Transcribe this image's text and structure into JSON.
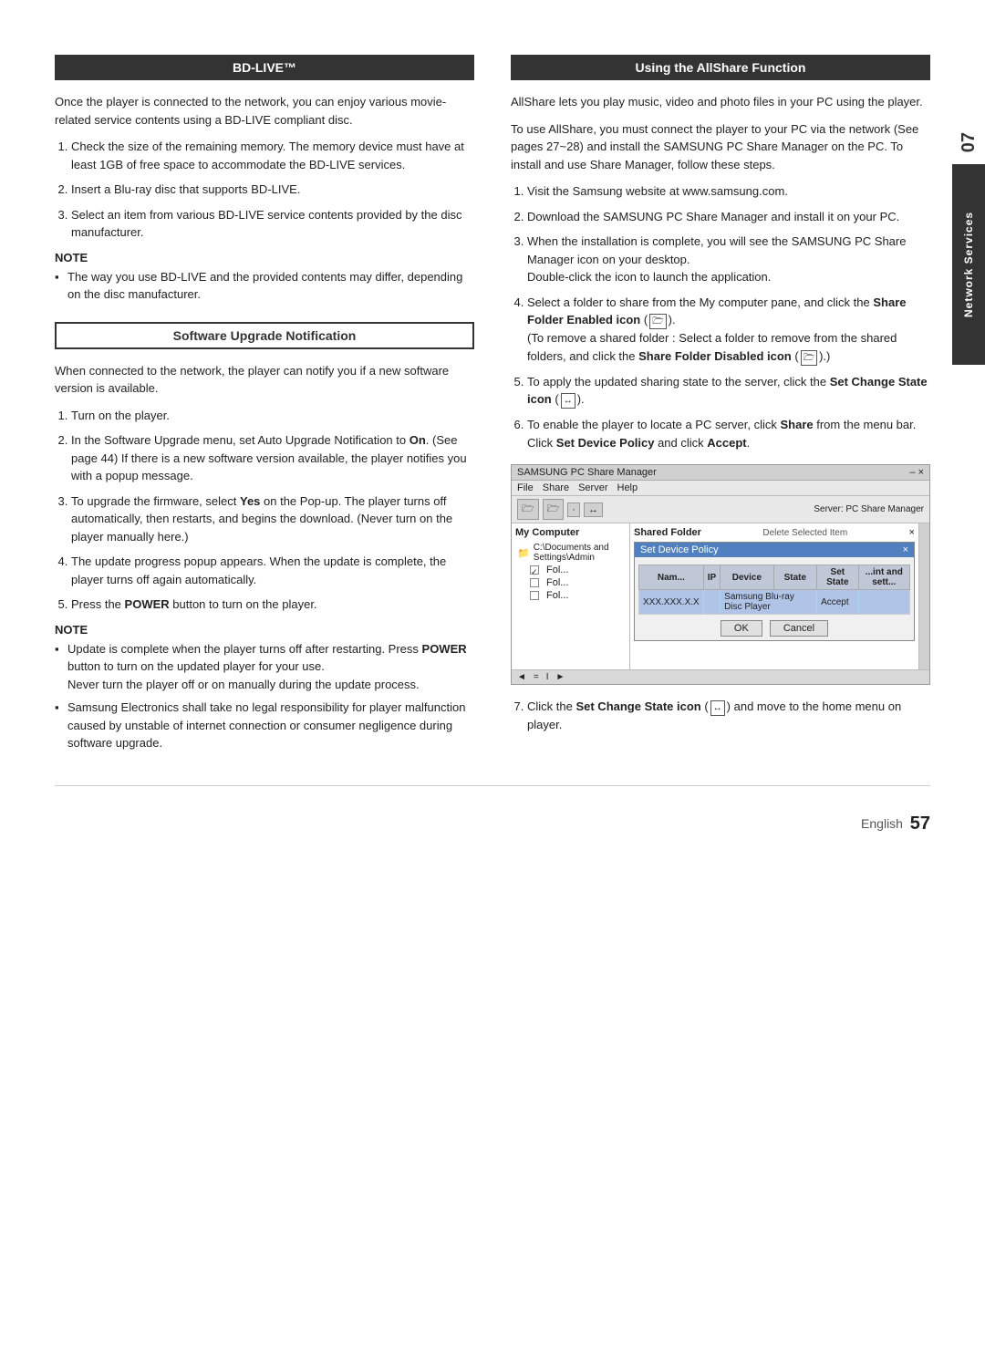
{
  "page": {
    "side_tab": "Network Services",
    "side_tab_number": "07",
    "footer": {
      "language": "English",
      "page_number": "57"
    }
  },
  "left_column": {
    "bd_live_header": "BD-LIVE™",
    "bd_live_intro": "Once the player is connected to the network, you can enjoy various movie-related service contents using a BD-LIVE compliant disc.",
    "bd_live_steps": [
      {
        "num": "1.",
        "text": "Check the size of the remaining memory. The memory device must have at least 1GB of free space to accommodate the BD-LIVE services."
      },
      {
        "num": "2.",
        "text": "Insert a Blu-ray disc that supports BD-LIVE."
      },
      {
        "num": "3.",
        "text": "Select an item from various BD-LIVE service contents provided by the disc manufacturer."
      }
    ],
    "note_label": "NOTE",
    "note_items": [
      "The way you use BD-LIVE and the provided contents may differ, depending on the disc manufacturer."
    ],
    "software_header": "Software Upgrade Notification",
    "software_intro": "When connected to the network, the player can notify you if a new software version is available.",
    "software_steps": [
      {
        "num": "1.",
        "text": "Turn on the player."
      },
      {
        "num": "2.",
        "text": "In the Software Upgrade menu, set Auto Upgrade Notification to On. (See page 44) If there is a new software version available, the player notifies you with a popup message."
      },
      {
        "num": "3.",
        "text": "To upgrade the firmware, select Yes on the Pop-up. The player turns off automatically, then restarts, and begins the download. (Never turn on the player manually here.)"
      },
      {
        "num": "4.",
        "text": "The update progress popup appears. When the update is complete, the player turns off again automatically."
      },
      {
        "num": "5.",
        "text": "Press the POWER button to turn on the player."
      }
    ],
    "note2_label": "NOTE",
    "note2_items": [
      "Update is complete when the player turns off after restarting. Press the POWER button to turn on the updated player for your use.\nNever turn the player off or on manually during the update process.",
      "Samsung Electronics shall take no legal responsibility for player malfunction caused by unstable of internet connection or consumer negligence during software upgrade."
    ]
  },
  "right_column": {
    "allshare_header": "Using the AllShare Function",
    "allshare_intro": "AllShare lets you play music, video and photo files in your PC using the player.",
    "allshare_body": "To use AllShare, you must connect the player to your PC via the network (See pages 27~28) and install the SAMSUNG PC Share Manager on the PC. To install and use Share Manager, follow these steps.",
    "allshare_steps": [
      {
        "num": "1.",
        "text": "Visit the Samsung website at www.samsung.com."
      },
      {
        "num": "2.",
        "text": "Download the SAMSUNG PC Share Manager and install it on your PC."
      },
      {
        "num": "3.",
        "text": "When the installation is complete, you will see the SAMSUNG PC Share Manager icon on your desktop.\nDouble-click the icon to launch the application."
      },
      {
        "num": "4.",
        "text": "Select a folder to share from the My computer pane, and click the Share Folder Enabled icon (",
        "icon_text": "📁",
        "text_after": ").\n(To remove a shared folder : Select a folder to remove from the shared folders, and click the Share Folder Disabled icon (",
        "icon_text2": "📁",
        "text_after2": ").)"
      },
      {
        "num": "5.",
        "text": "To apply the updated sharing state to the server, click the Set Change State icon (",
        "icon_text": "⊞",
        "text_after": ")."
      },
      {
        "num": "6.",
        "text": "To enable the player to locate a PC server, click Share from the menu bar.\nClick Set Device Policy and click Accept."
      }
    ],
    "screenshot": {
      "title": "SAMSUNG PC Share Manager",
      "close_btn": "– ×",
      "menu_items": [
        "File",
        "Share",
        "Server",
        "Help"
      ],
      "toolbar_btns": [
        "📁",
        "📁",
        "·",
        "↔"
      ],
      "server_label": "Server: PC Share Manager",
      "dialog_title": "Set Device Policy",
      "dialog_close": "×",
      "left_panel_title": "My Computer",
      "left_panel_items": [
        "C:\\Documents and Settings\\Admin",
        "Fol...",
        "Fol...",
        "Fol..."
      ],
      "right_panel_title": "Shared Folder",
      "right_panel_label": "Delete Selected Item",
      "table_headers": [
        "Nam...",
        "IP",
        "Device",
        "State",
        "Set State",
        "...int and sett..."
      ],
      "table_row": [
        "XXX.XXX.X.X Samsung Blu-ray Disc Player",
        "",
        "",
        "",
        "Accept",
        ""
      ],
      "ok_btn": "OK",
      "cancel_btn": "Cancel",
      "status_items": [
        "◄",
        "=",
        "I",
        "►"
      ]
    },
    "step7": {
      "num": "7.",
      "text": "Click the Set Change State icon (",
      "icon_text": "↔",
      "text_after": ") and move to the home menu on player."
    }
  }
}
